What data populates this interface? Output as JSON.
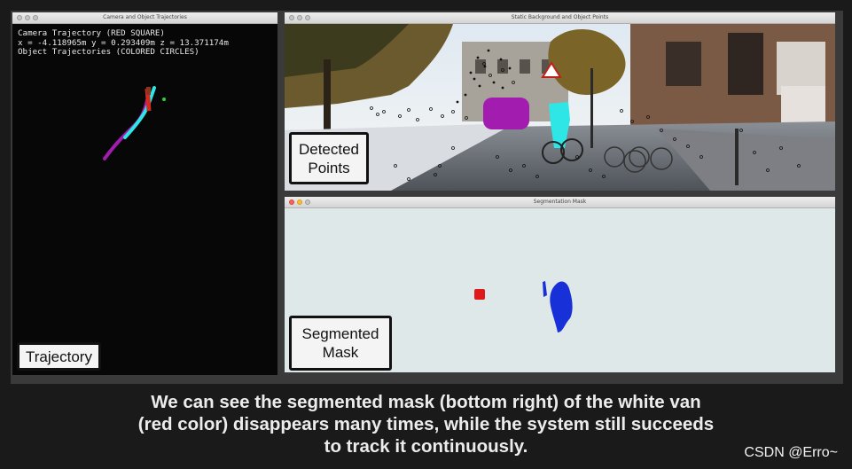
{
  "windows": {
    "trajectory": {
      "title": "Camera and Object Trajectories",
      "lines": [
        "Camera Trajectory (RED SQUARE)",
        "x = -4.118965m y = 0.293409m z = 13.371174m",
        "Object Trajectories (COLORED CIRCLES)"
      ],
      "overlay_label": "Trajectory"
    },
    "static": {
      "title": "Static Background and Object Points",
      "overlay_label_line1": "Detected",
      "overlay_label_line2": "Points"
    },
    "segmentation": {
      "title": "Segmentation Mask",
      "overlay_label_line1": "Segmented",
      "overlay_label_line2": "Mask"
    }
  },
  "caption": {
    "line1": "We can see the segmented mask (bottom right) of the white van",
    "line2": "(red color) disappears many times, while the system still succeeds",
    "line3": "to track it continuously."
  },
  "watermark": "CSDN @Erro~",
  "colors": {
    "camera_trajectory": "#d42a1e",
    "object_magenta": "#a21caf",
    "object_cyan": "#2ee6e6",
    "object_green": "#2bd62b",
    "mask_red": "#e01a1a",
    "mask_blue": "#1830d8"
  }
}
